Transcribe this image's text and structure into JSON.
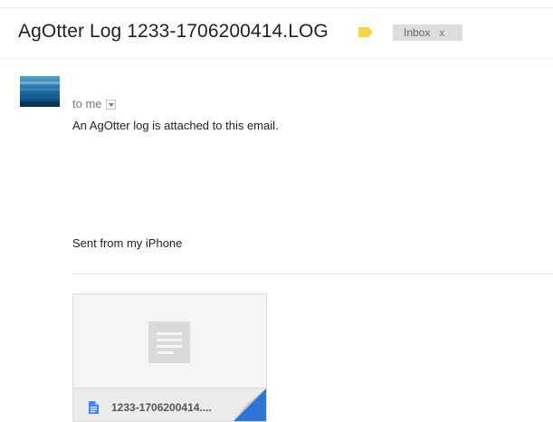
{
  "email": {
    "subject": "AgOtter Log 1233-1706200414.LOG",
    "label_color": "#f7d14b",
    "inbox_chip": {
      "label": "Inbox",
      "remove": "x"
    },
    "recipient_line": "to me",
    "body_text": "An AgOtter log is attached to this email.",
    "signature": "Sent from my iPhone"
  },
  "attachment": {
    "name": "1233-1706200414....",
    "file_icon": "document-icon",
    "accent_color": "#2f72d8"
  },
  "icons": {
    "label": "label-tag-icon",
    "caret": "chevron-down-icon",
    "preview": "document-preview-icon"
  }
}
